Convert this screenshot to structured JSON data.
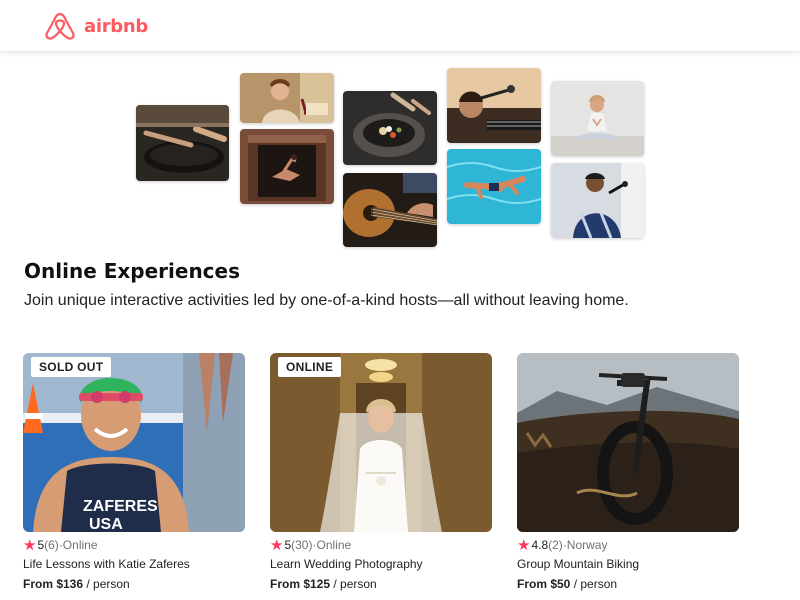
{
  "header": {
    "logo_text": "airbnb",
    "logo_icon": "airbnb-belo-icon",
    "brand_color": "#ff5a5f"
  },
  "collage": {
    "photos": [
      "cooking-pan-photo",
      "woman-with-wine-photo",
      "dancer-in-doorway-photo",
      "plated-dish-photo",
      "guitar-playing-photo",
      "singer-with-mic-photo",
      "swimmer-photo",
      "meditation-photo",
      "rapper-performing-photo"
    ]
  },
  "section": {
    "title": "Online Experiences",
    "subtitle": "Join unique interactive activities led by one-of-a-kind hosts—all without leaving home."
  },
  "cards": [
    {
      "badge": "SOLD OUT",
      "rating": "5",
      "reviews": "(6)",
      "location": "·Online",
      "title": "Life Lessons with Katie Zaferes",
      "price": "From $136",
      "per": " / person",
      "photo": "triathlete-photo"
    },
    {
      "badge": "ONLINE",
      "rating": "5",
      "reviews": "(30)",
      "location": "·Online",
      "title": "Learn Wedding Photography",
      "price": "From $125",
      "per": " / person",
      "photo": "bride-photo"
    },
    {
      "badge": "",
      "rating": "4.8",
      "reviews": "(2)",
      "location": "·Norway",
      "title": "Group Mountain Biking",
      "price": "From $50",
      "per": " / person",
      "photo": "mountain-bike-photo"
    }
  ],
  "star_icon": "star-icon",
  "star_color": "#ff385c"
}
